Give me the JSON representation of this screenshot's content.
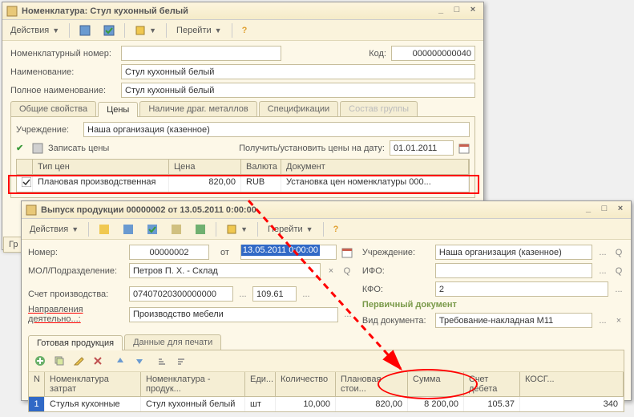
{
  "window1": {
    "title": "Номенклатура: Стул кухонный белый",
    "toolbar": {
      "actions": "Действия",
      "goto": "Перейти"
    },
    "labels": {
      "nom_number": "Номенклатурный номер:",
      "code": "Код:",
      "code_val": "000000000040",
      "name": "Наименование:",
      "name_val": "Стул кухонный белый",
      "fullname": "Полное наименование:",
      "fullname_val": "Стул кухонный белый"
    },
    "tabs": [
      "Общие свойства",
      "Цены",
      "Наличие драг. металлов",
      "Спецификации",
      "Состав группы"
    ],
    "prices": {
      "org_label": "Учреждение:",
      "org_val": "Наша организация (казенное)",
      "save_prices": "Записать цены",
      "get_set_label": "Получить/установить цены на дату:",
      "date": "01.01.2011",
      "columns": [
        "Тип цен",
        "Цена",
        "Валюта",
        "Документ"
      ],
      "row": {
        "type": "Плановая производственная",
        "price": "820,00",
        "currency": "RUB",
        "doc": "Установка цен номенклатуры 000..."
      }
    }
  },
  "window2": {
    "title": "Выпуск продукции 00000002 от 13.05.2011 0:00:00",
    "toolbar": {
      "actions": "Действия",
      "goto": "Перейти"
    },
    "labels": {
      "number": "Номер:",
      "number_val": "00000002",
      "from": "от",
      "date_val": "13.05.2011 0:00:00",
      "mol": "МОЛ/Подразделение:",
      "mol_val": "Петров П. Х. - Склад",
      "org": "Учреждение:",
      "org_val": "Наша организация (казенное)",
      "ifo": "ИФО:",
      "kfo": "КФО:",
      "kfo_val": "2",
      "account": "Счет производства:",
      "account_val": "07407020300000000",
      "account_code": "109.61",
      "directions": "Направления деятельно...:",
      "directions_val": "Производство мебели",
      "primary_doc": "Первичный документ",
      "doc_type": "Вид документа:",
      "doc_type_val": "Требование-накладная М11"
    },
    "tabs": [
      "Готовая продукция",
      "Данные для печати"
    ],
    "grid": {
      "columns": [
        "N",
        "Номенклатура затрат",
        "Номенклатура - продук...",
        "Еди...",
        "Количество",
        "Плановая стои...",
        "Сумма",
        "Счет дебета",
        "КОСГ..."
      ],
      "row": {
        "n": "1",
        "cost_nom": "Стулья кухонные",
        "prod_nom": "Стул кухонный белый",
        "unit": "шт",
        "qty": "10,000",
        "plan_cost": "820,00",
        "sum": "8 200,00",
        "debit": "105.37",
        "kosgu": "340"
      }
    }
  },
  "g_label": "Гр"
}
